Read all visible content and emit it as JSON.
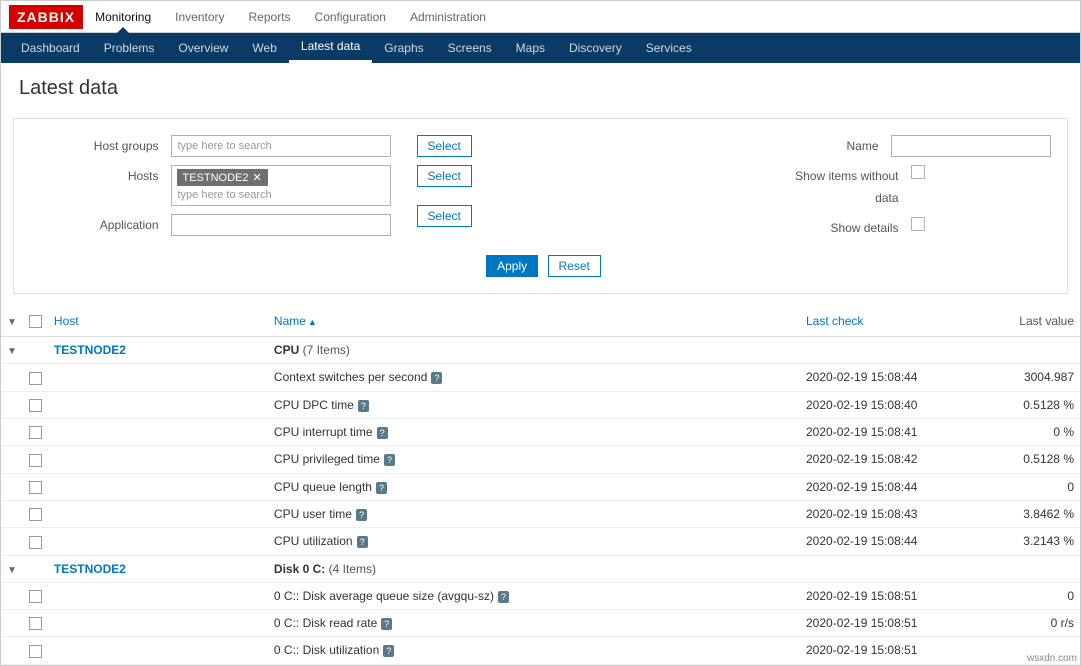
{
  "brand": "ZABBIX",
  "topnav": [
    "Monitoring",
    "Inventory",
    "Reports",
    "Configuration",
    "Administration"
  ],
  "topnav_active": 0,
  "subnav": [
    "Dashboard",
    "Problems",
    "Overview",
    "Web",
    "Latest data",
    "Graphs",
    "Screens",
    "Maps",
    "Discovery",
    "Services"
  ],
  "subnav_active": 4,
  "page_title": "Latest data",
  "filter": {
    "host_groups_label": "Host groups",
    "host_groups_placeholder": "type here to search",
    "hosts_label": "Hosts",
    "hosts_tag": "TESTNODE2",
    "hosts_placeholder": "type here to search",
    "application_label": "Application",
    "name_label": "Name",
    "show_without_label": "Show items without data",
    "show_details_label": "Show details",
    "select_btn": "Select",
    "apply_btn": "Apply",
    "reset_btn": "Reset"
  },
  "columns": {
    "host": "Host",
    "name": "Name",
    "last_check": "Last check",
    "last_value": "Last value"
  },
  "groups": [
    {
      "host": "TESTNODE2",
      "app": "CPU",
      "count": "(7 Items)",
      "rows": [
        {
          "name": "Context switches per second",
          "last": "2020-02-19 15:08:44",
          "value": "3004.987"
        },
        {
          "name": "CPU DPC time",
          "last": "2020-02-19 15:08:40",
          "value": "0.5128 %"
        },
        {
          "name": "CPU interrupt time",
          "last": "2020-02-19 15:08:41",
          "value": "0 %"
        },
        {
          "name": "CPU privileged time",
          "last": "2020-02-19 15:08:42",
          "value": "0.5128 %"
        },
        {
          "name": "CPU queue length",
          "last": "2020-02-19 15:08:44",
          "value": "0"
        },
        {
          "name": "CPU user time",
          "last": "2020-02-19 15:08:43",
          "value": "3.8462 %"
        },
        {
          "name": "CPU utilization",
          "last": "2020-02-19 15:08:44",
          "value": "3.2143 %"
        }
      ]
    },
    {
      "host": "TESTNODE2",
      "app": "Disk 0 C:",
      "count": "(4 Items)",
      "rows": [
        {
          "name": "0 C:: Disk average queue size (avgqu-sz)",
          "last": "2020-02-19 15:08:51",
          "value": "0"
        },
        {
          "name": "0 C:: Disk read rate",
          "last": "2020-02-19 15:08:51",
          "value": "0 r/s"
        },
        {
          "name": "0 C:: Disk utilization",
          "last": "2020-02-19 15:08:51",
          "value": ""
        }
      ]
    }
  ],
  "footer": "wsxdn.com"
}
